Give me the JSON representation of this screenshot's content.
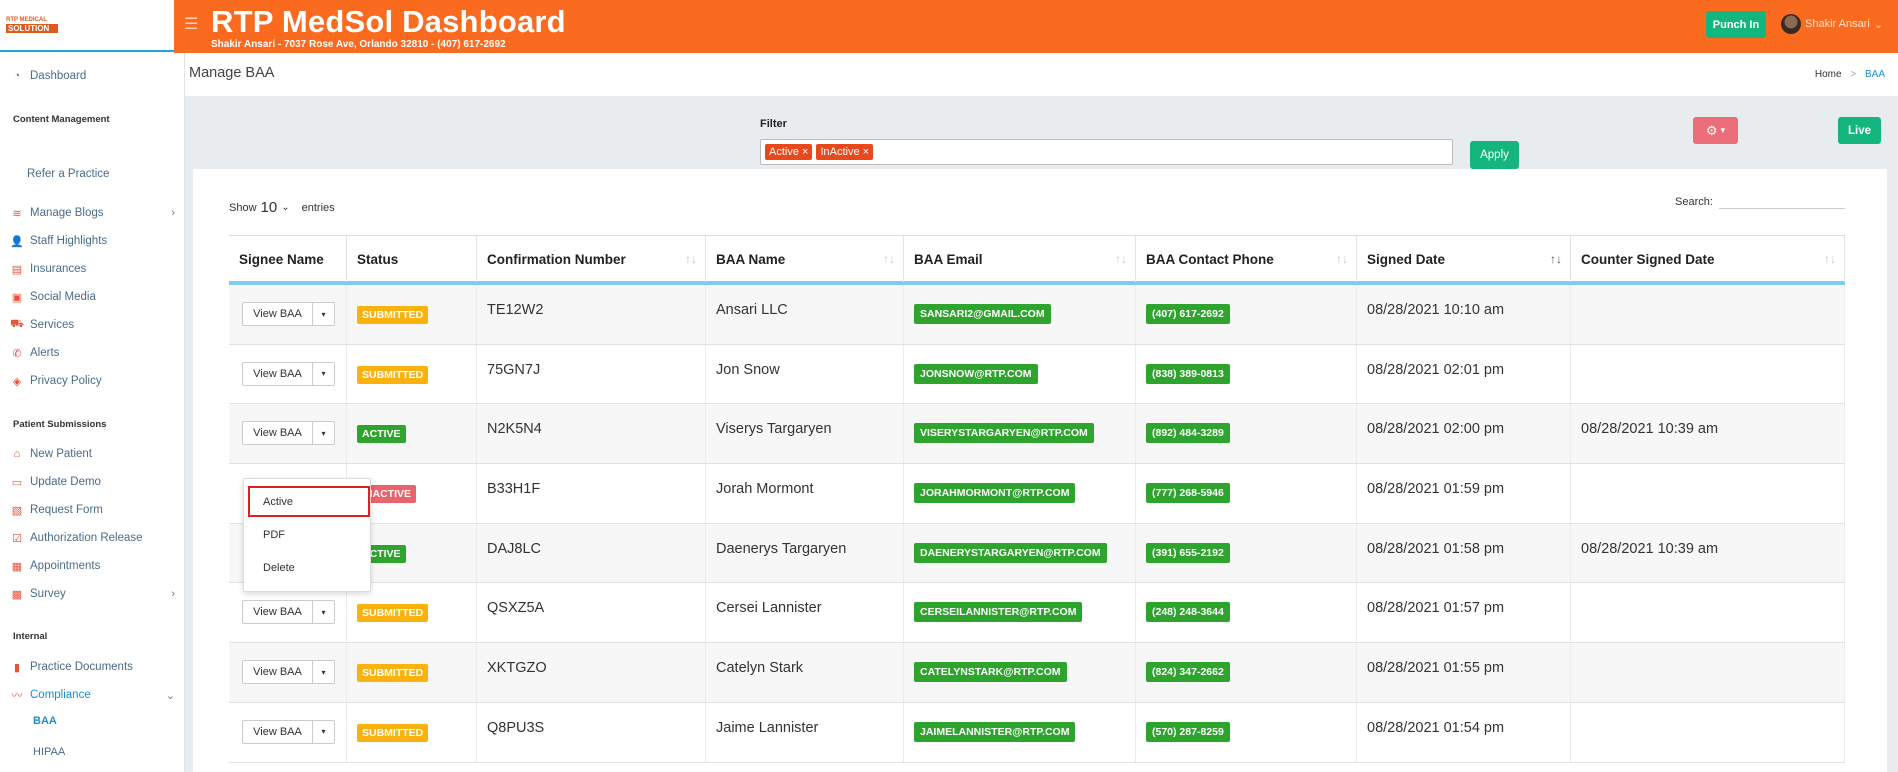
{
  "app": {
    "logo_line1": "RTP MEDICAL",
    "logo_line2": "SOLUTION",
    "title": "RTP MedSol Dashboard",
    "subtitle": "Shakir Ansari - 7037 Rose Ave, Orlando 32810 - (407) 617-2692",
    "punch_in": "Punch In",
    "user_name": "Shakir Ansari",
    "user_caret": "⌄"
  },
  "sidebar": {
    "dashboard": "Dashboard",
    "content_management": "Content Management",
    "refer": "Refer a Practice",
    "items_content": [
      {
        "label": "Manage Blogs",
        "icon": "rss-icon",
        "chev": "›"
      },
      {
        "label": "Staff Highlights",
        "icon": "user-icon"
      },
      {
        "label": "Insurances",
        "icon": "clipboard-icon"
      },
      {
        "label": "Social Media",
        "icon": "share-icon"
      },
      {
        "label": "Services",
        "icon": "services-icon"
      },
      {
        "label": "Alerts",
        "icon": "phone-icon"
      },
      {
        "label": "Privacy Policy",
        "icon": "shield-icon"
      }
    ],
    "patient_submissions": "Patient Submissions",
    "items_patient": [
      {
        "label": "New Patient",
        "icon": "home-icon"
      },
      {
        "label": "Update Demo",
        "icon": "id-card-icon"
      },
      {
        "label": "Request Form",
        "icon": "file-icon"
      },
      {
        "label": "Authorization Release",
        "icon": "check-file-icon"
      },
      {
        "label": "Appointments",
        "icon": "calendar-icon"
      },
      {
        "label": "Survey",
        "icon": "survey-icon",
        "chev": "›"
      }
    ],
    "internal": "Internal",
    "practice_documents": "Practice Documents",
    "compliance": "Compliance",
    "compliance_chev": "⌄",
    "sub_baa": "BAA",
    "sub_hipaa": "HIPAA"
  },
  "page": {
    "title": "Manage BAA",
    "crumb_home": "Home",
    "crumb_sep": ">",
    "crumb_current": "BAA"
  },
  "filter": {
    "label": "Filter",
    "chips": [
      "Active ×",
      "InActive ×"
    ],
    "apply": "Apply",
    "settings_caret": "▾",
    "live": "Live"
  },
  "table_controls": {
    "show": "Show",
    "entries_count": "10",
    "entries_caret": "⌄",
    "entries": "entries",
    "search": "Search:"
  },
  "table": {
    "headers": [
      "Signee Name",
      "Status",
      "Confirmation Number",
      "BAA Name",
      "BAA Email",
      "BAA Contact Phone",
      "Signed Date",
      "Counter Signed Date"
    ],
    "sort_icon": "↑↓",
    "view_label": "View BAA",
    "view_caret": "▾",
    "rows": [
      {
        "status": "SUBMITTED",
        "status_kind": "sub",
        "conf": "TE12W2",
        "name": "Ansari LLC",
        "email": "SANSARI2@GMAIL.COM",
        "phone": "(407) 617-2692",
        "signed": "08/28/2021 10:10 am",
        "counter": ""
      },
      {
        "status": "SUBMITTED",
        "status_kind": "sub",
        "conf": "75GN7J",
        "name": "Jon Snow",
        "email": "JONSNOW@RTP.COM",
        "phone": "(838) 389-0813",
        "signed": "08/28/2021 02:01 pm",
        "counter": ""
      },
      {
        "status": "ACTIVE",
        "status_kind": "act",
        "conf": "N2K5N4",
        "name": "Viserys Targaryen",
        "email": "VISERYSTARGARYEN@RTP.COM",
        "phone": "(892) 484-3289",
        "signed": "08/28/2021 02:00 pm",
        "counter": "08/28/2021 10:39 am"
      },
      {
        "status": "INACTIVE",
        "status_kind": "ina",
        "conf": "B33H1F",
        "name": "Jorah Mormont",
        "email": "JORAHMORMONT@RTP.COM",
        "phone": "(777) 268-5946",
        "signed": "08/28/2021 01:59 pm",
        "counter": ""
      },
      {
        "status": "ACTIVE",
        "status_kind": "act",
        "conf": "DAJ8LC",
        "name": "Daenerys Targaryen",
        "email": "DAENERYSTARGARYEN@RTP.COM",
        "phone": "(391) 655-2192",
        "signed": "08/28/2021 01:58 pm",
        "counter": "08/28/2021 10:39 am"
      },
      {
        "status": "SUBMITTED",
        "status_kind": "sub",
        "conf": "QSXZ5A",
        "name": "Cersei Lannister",
        "email": "CERSEILANNISTER@RTP.COM",
        "phone": "(248) 248-3644",
        "signed": "08/28/2021 01:57 pm",
        "counter": ""
      },
      {
        "status": "SUBMITTED",
        "status_kind": "sub",
        "conf": "XKTGZO",
        "name": "Catelyn Stark",
        "email": "CATELYNSTARK@RTP.COM",
        "phone": "(824) 347-2662",
        "signed": "08/28/2021 01:55 pm",
        "counter": ""
      },
      {
        "status": "SUBMITTED",
        "status_kind": "sub",
        "conf": "Q8PU3S",
        "name": "Jaime Lannister",
        "email": "JAIMELANNISTER@RTP.COM",
        "phone": "(570) 287-8259",
        "signed": "08/28/2021 01:54 pm",
        "counter": ""
      }
    ]
  },
  "dropdown": {
    "items": [
      "Active",
      "PDF",
      "Delete"
    ]
  }
}
